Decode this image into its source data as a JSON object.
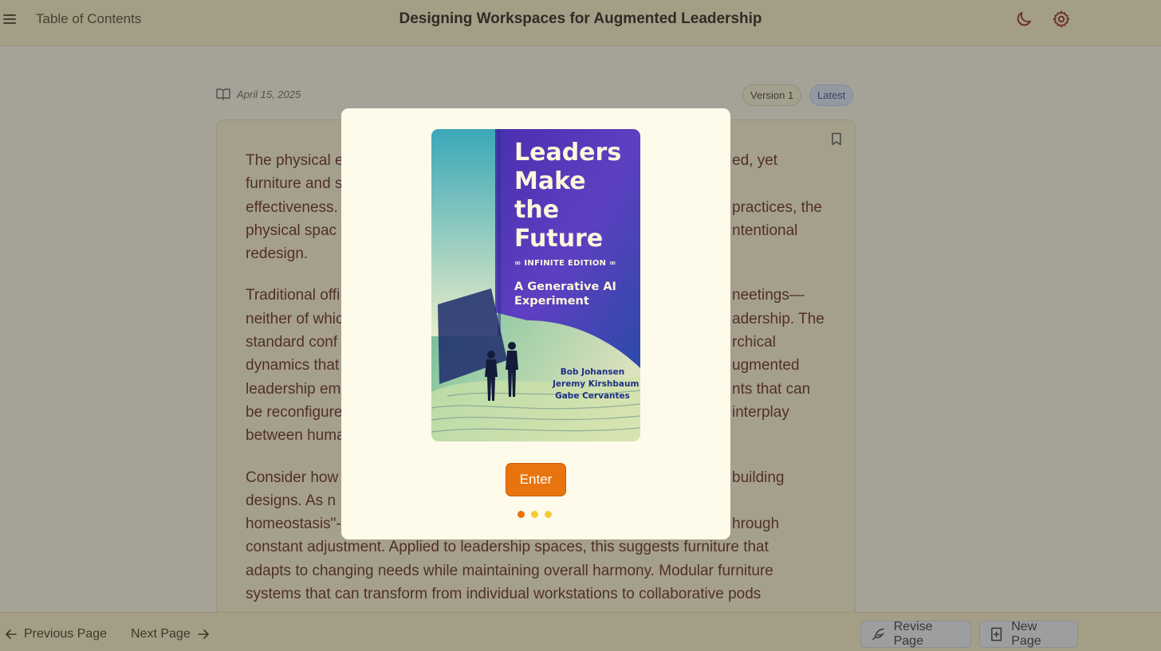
{
  "header": {
    "toc_label": "Table of Contents",
    "title": "Designing Workspaces for Augmented Leadership",
    "icons": [
      "menu-icon",
      "moon-icon",
      "gear-icon"
    ]
  },
  "meta": {
    "date": "April 15, 2025",
    "version_label": "Version 1",
    "latest_label": "Latest"
  },
  "content": {
    "paragraphs": [
      "The physical e… …ed, yet furniture and s… …effectiveness. … …practices, the physical space… …ntentional redesign.",
      "Traditional offi… …neetings—neither of which… …adership. The standard conf… …rchical dynamics that… …ugmented leadership em… …nts that can be reconfigure… …interplay between huma…",
      "Consider how… …building designs. As n… homeostasis\"… …hrough constant adjustment. Applied to leadership spaces, this suggests furniture that adapts to changing needs while maintaining overall harmony. Modular furniture systems that can transform from individual workstations to collaborative pods"
    ],
    "lines": [
      [
        "The physical e",
        "ed, yet"
      ],
      [
        "furniture and s",
        ""
      ],
      [
        "effectiveness.",
        "practices, the"
      ],
      [
        "physical spac",
        "ntentional"
      ],
      [
        "redesign.",
        ""
      ],
      [
        "Traditional offi",
        "neetings—"
      ],
      [
        "neither of whic",
        "adership. The"
      ],
      [
        "standard conf",
        "rchical"
      ],
      [
        "dynamics that",
        "ugmented"
      ],
      [
        "leadership em",
        "nts that can"
      ],
      [
        "be reconfigure",
        "interplay"
      ],
      [
        "between huma",
        ""
      ],
      [
        "Consider how",
        "building"
      ],
      [
        "designs. As n",
        ""
      ],
      [
        "homeostasis\"-",
        "hrough"
      ],
      [
        "constant adjustment. Applied to leadership spaces, this suggests furniture that",
        ""
      ],
      [
        "adapts to changing needs while maintaining overall harmony. Modular furniture",
        ""
      ],
      [
        "systems that can transform from individual workstations to collaborative pods",
        ""
      ]
    ]
  },
  "footer": {
    "prev_label": "Previous Page",
    "next_label": "Next Page",
    "revise_label": "Revise Page",
    "new_label": "New Page"
  },
  "modal": {
    "cover": {
      "title_lines": [
        "Leaders",
        "Make",
        "the",
        "Future"
      ],
      "edition": "∞ INFINITE EDITION ∞",
      "subtitle_lines": [
        "A Generative AI",
        "Experiment"
      ],
      "authors": [
        "Bob Johansen",
        "Jeremy Kirshbaum",
        "Gabe Cervantes"
      ]
    },
    "enter_label": "Enter",
    "carousel": {
      "count": 3,
      "active_index": 0
    }
  },
  "colors": {
    "accent": "#e8740f",
    "dot_inactive": "#f3cb34",
    "body_text": "#5a1a14",
    "header_bg": "#fbf0c2"
  }
}
